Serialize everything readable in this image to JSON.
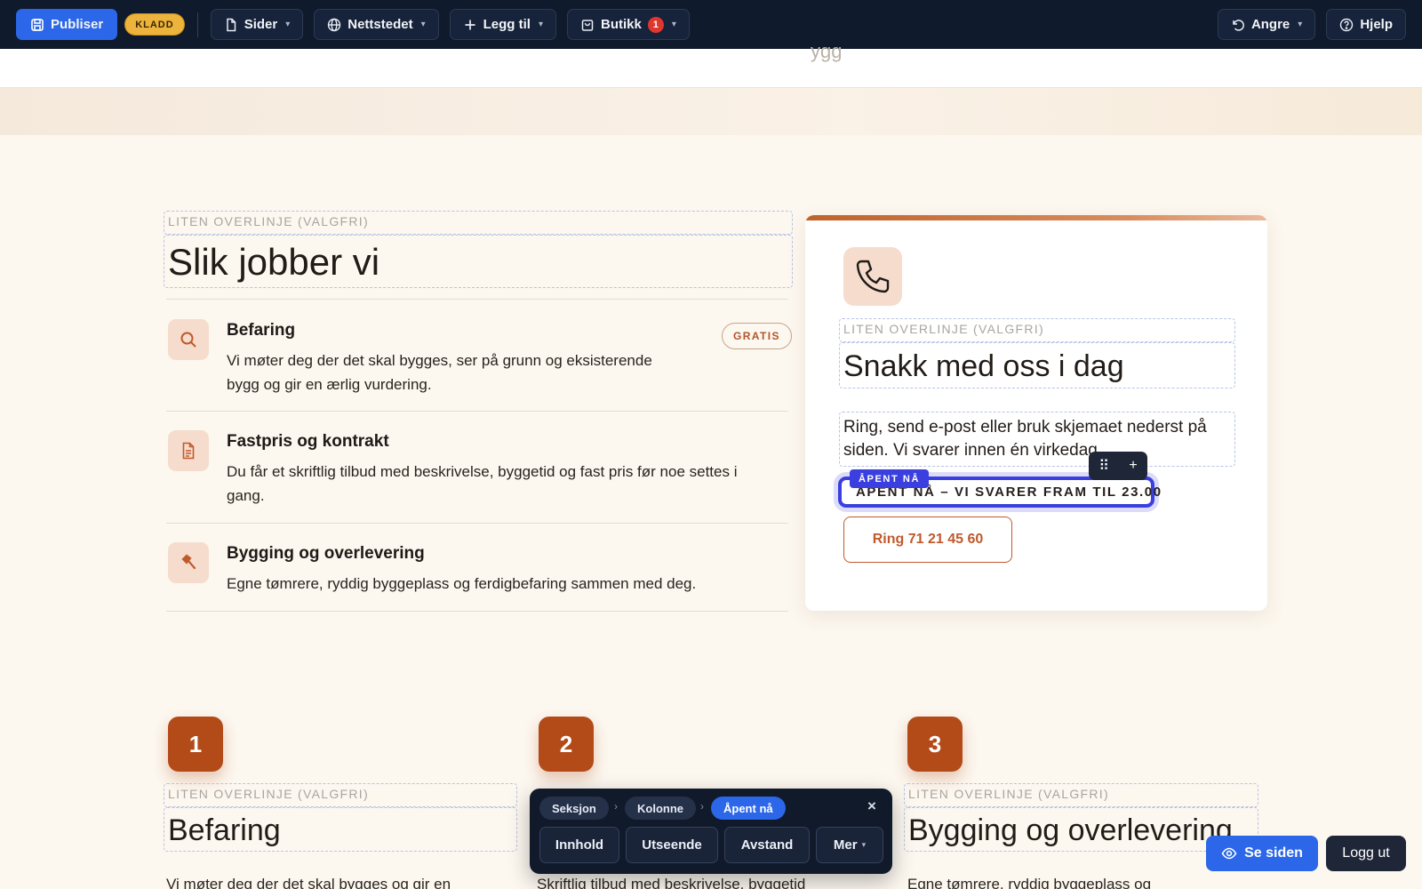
{
  "toolbar": {
    "publish_label": "Publiser",
    "status_badge": "KLADD",
    "pages_label": "Sider",
    "site_label": "Nettstedet",
    "add_label": "Legg til",
    "shop_label": "Butikk",
    "shop_count": "1",
    "undo_label": "Angre",
    "help_label": "Hjelp"
  },
  "clipped_text": "ygg",
  "process": {
    "overline": "LITEN OVERLINJE (VALGFRI)",
    "heading": "Slik jobber vi",
    "steps": [
      {
        "icon": "search-icon",
        "title": "Befaring",
        "desc_line1": "Vi møter deg der det skal bygges, ser på grunn og eksisterende",
        "desc_line2": "bygg og gir en ærlig vurdering.",
        "badge": "GRATIS"
      },
      {
        "icon": "document-icon",
        "title": "Fastpris og kontrakt",
        "desc_line1": "Du får et skriftlig tilbud med beskrivelse, byggetid og fast pris før noe settes i",
        "desc_line2": "gang."
      },
      {
        "icon": "hammer-icon",
        "title": "Bygging og overlevering",
        "desc_line1": "Egne tømrere, ryddig byggeplass og ferdigbefaring sammen med deg."
      }
    ]
  },
  "contact": {
    "icon": "phone-icon",
    "overline": "LITEN OVERLINJE (VALGFRI)",
    "heading": "Snakk med oss i dag",
    "body_line1": "Ring, send e-post eller bruk skjemaet nederst på",
    "body_line2": "siden. Vi svarer innen én virkedag.",
    "open_status": "ÅPENT NÅ – VI SVARER FRAM TIL 23.00",
    "selection_tag": "ÅPENT NÅ",
    "call_button": "Ring 71 21 45 60",
    "status_color": "#2aa84a"
  },
  "columns": [
    {
      "number": "1",
      "overline": "LITEN OVERLINJE (VALGFRI)",
      "heading": "Befaring",
      "text": "Vi møter deg der det skal bygges og gir en"
    },
    {
      "number": "2",
      "overline": "",
      "heading": "",
      "text": "Skriftlig tilbud med beskrivelse, byggetid"
    },
    {
      "number": "3",
      "overline": "LITEN OVERLINJE (VALGFRI)",
      "heading": "Bygging og overlevering",
      "text": "Egne tømrere, ryddig byggeplass og"
    }
  ],
  "editor": {
    "crumbs": [
      "Seksjon",
      "Kolonne",
      "Åpent nå"
    ],
    "tabs": [
      "Innhold",
      "Utseende",
      "Avstand",
      "Mer"
    ],
    "close_symbol": "×"
  },
  "actions": {
    "view_label": "Se siden",
    "logout_label": "Logg ut"
  },
  "colors": {
    "accent": "#2b67e8",
    "brand": "#b34b19",
    "selection": "#3b3fe0",
    "toolbar_bg": "#0f1a2c"
  }
}
